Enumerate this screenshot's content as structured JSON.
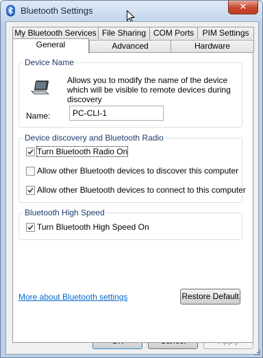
{
  "window": {
    "title": "Bluetooth Settings",
    "close_glyph": "✕"
  },
  "tabs_back": [
    {
      "label": "My Bluetooth Services"
    },
    {
      "label": "File Sharing"
    },
    {
      "label": "COM Ports"
    },
    {
      "label": "PIM Settings"
    }
  ],
  "tabs_front": [
    {
      "label": "General",
      "active": true
    },
    {
      "label": "Advanced",
      "active": false
    },
    {
      "label": "Hardware",
      "active": false
    }
  ],
  "device_name": {
    "legend": "Device Name",
    "description": "Allows you to modify the name of the device which will be visible to remote devices during discovery",
    "name_label": "Name:",
    "name_value": "PC-CLI-1",
    "icon": "laptop-icon"
  },
  "discovery": {
    "legend": "Device discovery and Bluetooth Radio",
    "options": [
      {
        "label": "Turn Bluetooth Radio On",
        "checked": true
      },
      {
        "label": "Allow other Bluetooth devices to discover this computer",
        "checked": false
      },
      {
        "label": "Allow other Bluetooth devices to connect to this computer",
        "checked": true
      }
    ]
  },
  "high_speed": {
    "legend": "Bluetooth High Speed",
    "options": [
      {
        "label": "Turn Bluetooth High Speed On",
        "checked": true
      }
    ]
  },
  "more_link": "More about Bluetooth settings",
  "restore_default": "Restore Default",
  "buttons": {
    "ok": "OK",
    "cancel": "Cancel",
    "apply": "Apply"
  },
  "colors": {
    "link": "#0066cc",
    "legend": "#1e3a6a",
    "titlebar": "#c4d6ec",
    "close": "#c7452b"
  }
}
